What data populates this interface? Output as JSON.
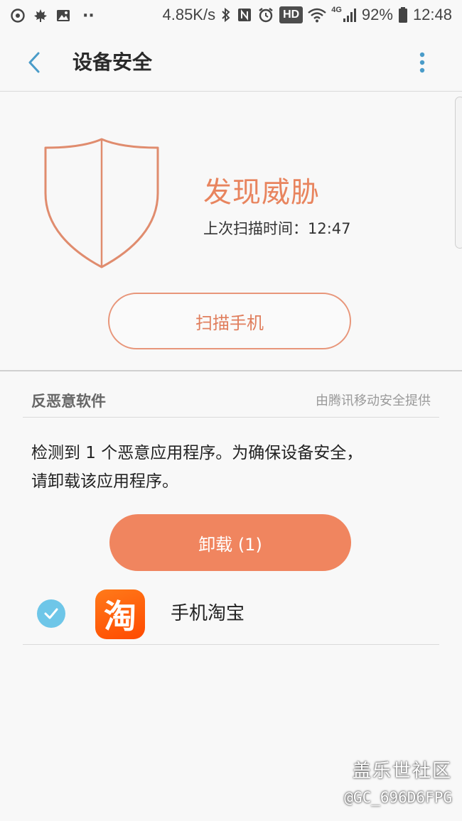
{
  "status_bar": {
    "left_dots": "··",
    "net_speed": "4.85K/s",
    "hd": "HD",
    "net_type": "4G",
    "battery": "92%",
    "time": "12:48"
  },
  "app_bar": {
    "title": "设备安全"
  },
  "header": {
    "threat_status": "发现威胁",
    "last_scan": "上次扫描时间：12:47",
    "scan_button": "扫描手机"
  },
  "anti_malware": {
    "section_title": "反恶意软件",
    "provider": "由腾讯移动安全提供",
    "description_line1": "检测到 1 个恶意应用程序。为确保设备安全，",
    "description_line2": "请卸载该应用程序。",
    "uninstall_button": "卸载 (1)",
    "apps": [
      {
        "name": "手机淘宝",
        "icon_glyph": "淘",
        "checked": true
      }
    ]
  },
  "watermark": {
    "site": "盖乐世社区",
    "user": "@GC_696D6FPG"
  },
  "colors": {
    "accent": "#e8845e",
    "button_fill": "#f0855f",
    "back_icon": "#4a9cc9",
    "check": "#6ec6e8",
    "app_icon": "#ff5a0a"
  }
}
